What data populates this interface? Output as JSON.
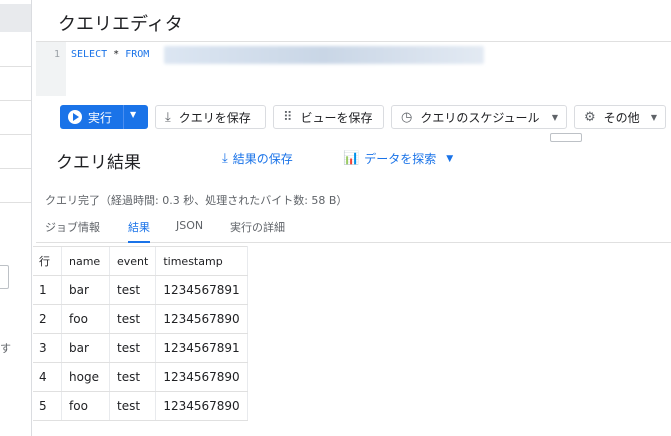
{
  "editor": {
    "title": "クエリエディタ",
    "line_number": "1",
    "code_keyword_select": "SELECT",
    "code_star": "*",
    "code_keyword_from": "FROM"
  },
  "toolbar": {
    "run_label": "実行",
    "save_query_label": "クエリを保存",
    "save_view_label": "ビューを保存",
    "schedule_label": "クエリのスケジュール",
    "other_label": "その他"
  },
  "results": {
    "title": "クエリ結果",
    "save_results_label": "結果の保存",
    "explore_data_label": "データを探索",
    "status": "クエリ完了（経過時間: 0.3 秒、処理されたバイト数: 58 B）",
    "tabs": [
      {
        "label": "ジョブ情報",
        "active": false
      },
      {
        "label": "結果",
        "active": true
      },
      {
        "label": "JSON",
        "active": false
      },
      {
        "label": "実行の詳細",
        "active": false
      }
    ],
    "columns": [
      "行",
      "name",
      "event",
      "timestamp"
    ],
    "rows": [
      [
        "1",
        "bar",
        "test",
        "1234567891"
      ],
      [
        "2",
        "foo",
        "test",
        "1234567890"
      ],
      [
        "3",
        "bar",
        "test",
        "1234567891"
      ],
      [
        "4",
        "hoge",
        "test",
        "1234567890"
      ],
      [
        "5",
        "foo",
        "test",
        "1234567890"
      ]
    ]
  },
  "sidebar": {
    "fragment_glyph": "す"
  },
  "colors": {
    "accent": "#1a73e8",
    "text": "#202124",
    "muted": "#5f6368",
    "border": "#e0e0e0"
  },
  "icons": {
    "run": "play-icon",
    "save_query": "save-icon",
    "save_view": "grid-icon",
    "schedule": "clock-icon",
    "other": "gear-icon",
    "save_results": "download-icon",
    "explore": "chart-icon"
  }
}
